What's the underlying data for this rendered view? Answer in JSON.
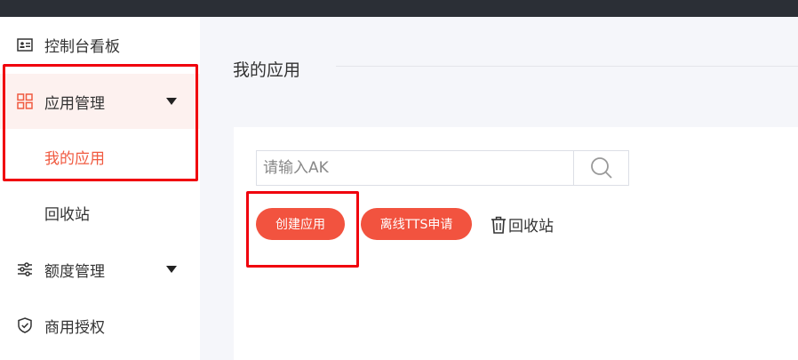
{
  "sidebar": {
    "items": [
      {
        "label": "控制台看板",
        "icon": "id-card-icon"
      },
      {
        "label": "应用管理",
        "icon": "grid-apps-icon",
        "expanded": true
      },
      {
        "label": "我的应用",
        "selected": true
      },
      {
        "label": "回收站"
      },
      {
        "label": "额度管理",
        "icon": "sliders-icon",
        "expanded": false
      },
      {
        "label": "商用授权",
        "icon": "shield-check-icon"
      }
    ]
  },
  "main": {
    "title": "我的应用",
    "search": {
      "placeholder": "请输入AK",
      "value": ""
    },
    "actions": {
      "create_label": "创建应用",
      "offline_tts_label": "离线TTS申请",
      "recycle_label": "回收站"
    }
  },
  "colors": {
    "accent": "#f2533f",
    "highlight_box": "#f0000d",
    "topbar": "#2b2f36"
  }
}
